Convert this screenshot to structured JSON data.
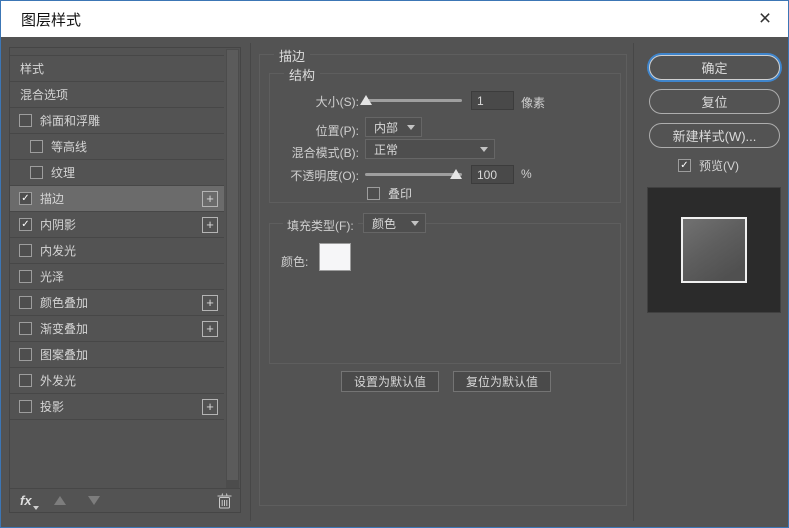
{
  "window": {
    "title": "图层样式",
    "close_glyph": "×"
  },
  "sidebar": {
    "items": [
      {
        "label": "样式",
        "checkbox": null,
        "selected": false,
        "plus": false,
        "indent": 0
      },
      {
        "label": "混合选项",
        "checkbox": null,
        "selected": false,
        "plus": false,
        "indent": 0
      },
      {
        "label": "斜面和浮雕",
        "checkbox": false,
        "selected": false,
        "plus": false,
        "indent": 0
      },
      {
        "label": "等高线",
        "checkbox": false,
        "selected": false,
        "plus": false,
        "indent": 1
      },
      {
        "label": "纹理",
        "checkbox": false,
        "selected": false,
        "plus": false,
        "indent": 1
      },
      {
        "label": "描边",
        "checkbox": true,
        "selected": true,
        "plus": true,
        "indent": 0
      },
      {
        "label": "内阴影",
        "checkbox": true,
        "selected": false,
        "plus": true,
        "indent": 0
      },
      {
        "label": "内发光",
        "checkbox": false,
        "selected": false,
        "plus": false,
        "indent": 0
      },
      {
        "label": "光泽",
        "checkbox": false,
        "selected": false,
        "plus": false,
        "indent": 0
      },
      {
        "label": "颜色叠加",
        "checkbox": false,
        "selected": false,
        "plus": true,
        "indent": 0
      },
      {
        "label": "渐变叠加",
        "checkbox": false,
        "selected": false,
        "plus": true,
        "indent": 0
      },
      {
        "label": "图案叠加",
        "checkbox": false,
        "selected": false,
        "plus": false,
        "indent": 0
      },
      {
        "label": "外发光",
        "checkbox": false,
        "selected": false,
        "plus": false,
        "indent": 0
      },
      {
        "label": "投影",
        "checkbox": false,
        "selected": false,
        "plus": true,
        "indent": 0
      }
    ],
    "footer": {
      "fx_label": "fx",
      "plus_glyph": "+",
      "check_glyph": "✓"
    }
  },
  "main": {
    "panel_title": "描边",
    "structure": {
      "legend": "结构",
      "size_label": "大小(S):",
      "size_value": "1",
      "size_unit": "像素",
      "position_label": "位置(P):",
      "position_value": "内部",
      "blend_label": "混合模式(B):",
      "blend_value": "正常",
      "opacity_label": "不透明度(O):",
      "opacity_value": "100",
      "opacity_unit": "%",
      "overprint_label": "叠印"
    },
    "fill": {
      "type_label": "填充类型(F):",
      "type_value": "颜色",
      "color_label": "颜色:"
    },
    "footer_buttons": {
      "set_default": "设置为默认值",
      "reset_default": "复位为默认值"
    }
  },
  "actions": {
    "ok": "确定",
    "reset": "复位",
    "new_style": "新建样式(W)...",
    "preview_label": "预览(V)",
    "preview_checked": true
  },
  "colors": {
    "window_border": "#3c76b5",
    "titlebar_bg": "#ffffff",
    "dialog_bg": "#535353",
    "selected_row_bg": "#6b6b6b",
    "focus_ring": "#3f85cc",
    "text": "#d8d8d8",
    "preview_bg": "#2b2b2b",
    "stroke_color_swatch": "#f6f6f8"
  }
}
